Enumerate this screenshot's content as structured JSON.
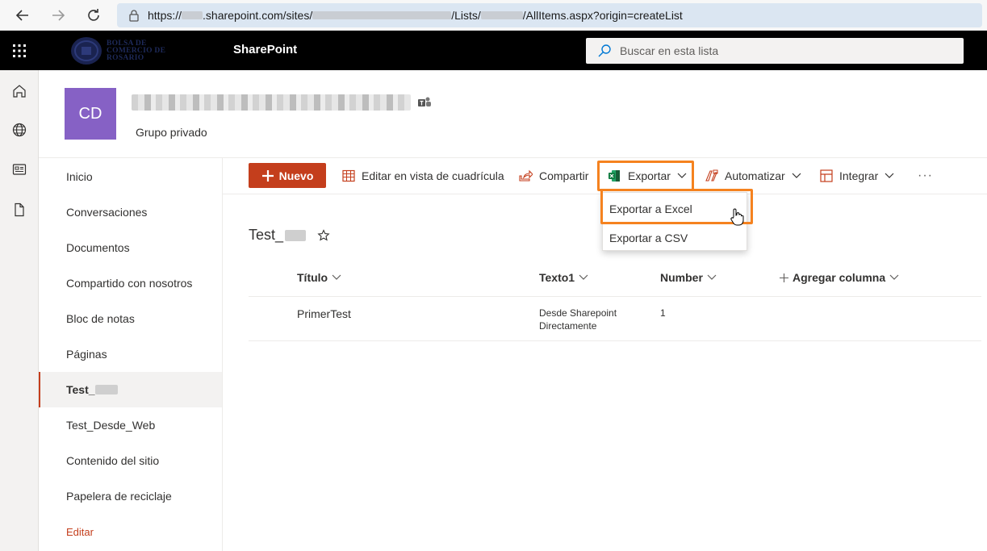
{
  "browser": {
    "url_prefix": "https://",
    "url_domain": ".sharepoint.com/sites/",
    "url_lists": "/Lists/",
    "url_suffix": "/AllItems.aspx?origin=createList"
  },
  "suitebar": {
    "logo_text": "BOLSA DE COMERCIO DE ROSARIO",
    "app_title": "SharePoint",
    "search_placeholder": "Buscar en esta lista"
  },
  "site": {
    "logo_initials": "CD",
    "subtitle": "Grupo privado"
  },
  "nav": {
    "items": [
      {
        "label": "Inicio"
      },
      {
        "label": "Conversaciones"
      },
      {
        "label": "Documentos"
      },
      {
        "label": "Compartido con nosotros"
      },
      {
        "label": "Bloc de notas"
      },
      {
        "label": "Páginas"
      },
      {
        "label": "Test_"
      },
      {
        "label": "Test_Desde_Web"
      },
      {
        "label": "Contenido del sitio"
      },
      {
        "label": "Papelera de reciclaje"
      }
    ],
    "edit_label": "Editar"
  },
  "commands": {
    "new_label": "Nuevo",
    "grid_label": "Editar en vista de cuadrícula",
    "share_label": "Compartir",
    "export_label": "Exportar",
    "automate_label": "Automatizar",
    "integrate_label": "Integrar",
    "more_label": "···"
  },
  "export_menu": {
    "items": [
      {
        "label": "Exportar a Excel"
      },
      {
        "label": "Exportar a CSV"
      }
    ]
  },
  "list": {
    "title": "Test_",
    "columns": [
      "Título",
      "Texto1",
      "Number",
      "Agregar columna"
    ],
    "rows": [
      {
        "titulo": "PrimerTest",
        "texto1_line1": "Desde Sharepoint",
        "texto1_line2": "Directamente",
        "number": "1"
      }
    ]
  },
  "colors": {
    "accent": "#c43e1c",
    "highlight": "#f5821f",
    "site_logo": "#8661c5"
  }
}
